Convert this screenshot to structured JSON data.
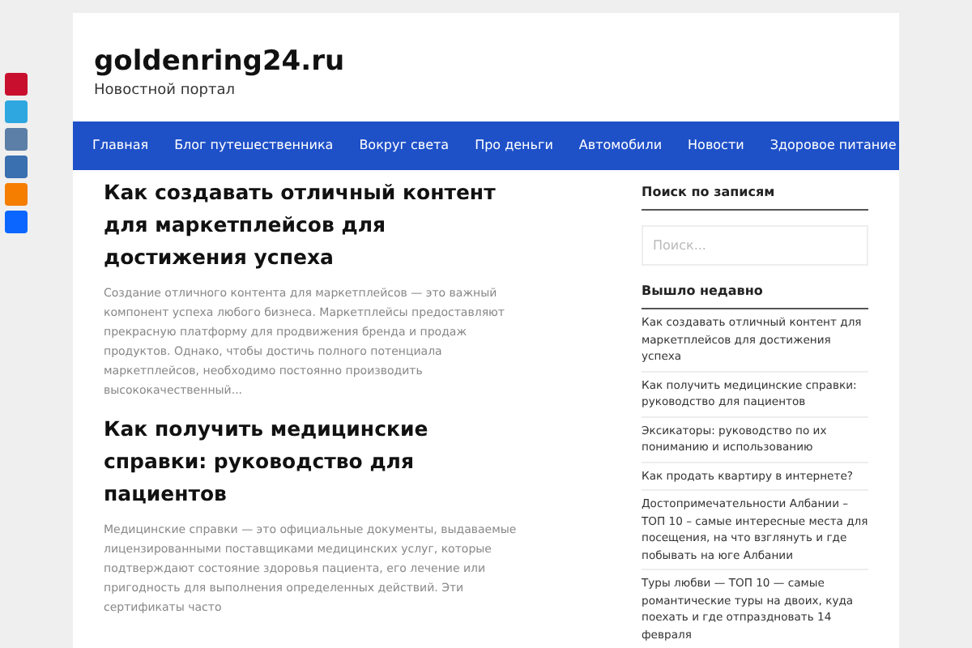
{
  "social_buttons": [
    {
      "color": "#c8102e"
    },
    {
      "color": "#2ea7e0"
    },
    {
      "color": "#5b7fa6"
    },
    {
      "color": "#3a6fb0"
    },
    {
      "color": "#f57d00"
    },
    {
      "color": "#0a66ff"
    }
  ],
  "site": {
    "title": "goldenring24.ru",
    "tagline": "Новостной портал"
  },
  "nav": [
    "Главная",
    "Блог путешественника",
    "Вокруг света",
    "Про деньги",
    "Автомобили",
    "Новости",
    "Здоровое питание"
  ],
  "posts": [
    {
      "title": "Как создавать отличный контент для маркетплейсов для достижения успеха",
      "excerpt": "Создание отличного контента для маркетплейсов — это важный компонент успеха любого бизнеса. Маркетплейсы предоставляют прекрасную платформу для продвижения бренда и продаж продуктов. Однако, чтобы достичь полного потенциала маркетплейсов, необходимо постоянно производить высококачественный..."
    },
    {
      "title": "Как получить медицинские справки: руководство для пациентов",
      "excerpt": "Медицинские справки — это официальные документы, выдаваемые лицензированными поставщиками медицинских услуг, которые подтверждают состояние здоровья пациента, его лечение или пригодность для выполнения определенных действий. Эти сертификаты часто"
    }
  ],
  "sidebar": {
    "search_title": "Поиск по записям",
    "search": {
      "placeholder": "Поиск..."
    },
    "recent_title": "Вышло недавно",
    "recent": [
      "Как создавать отличный контент для маркетплейсов для достижения успеха",
      "Как получить медицинские справки: руководство для пациентов",
      "Эксикаторы: руководство по их пониманию и использованию",
      "Как продать квартиру в интернете?",
      "Достопримечательности Албании – ТОП 10 – самые интересные места для посещения, на что взглянуть и где побывать на юге Албании",
      "Туры любви — ТОП 10 — самые романтические туры на двоих, куда поехать и где отпраздновать 14 февраля"
    ]
  }
}
